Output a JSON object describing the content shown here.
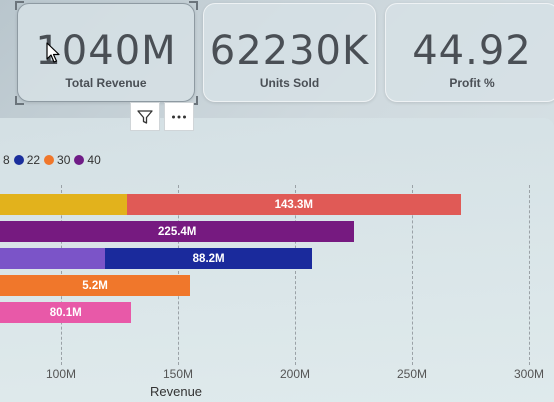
{
  "cards": [
    {
      "value": "1040M",
      "label": "Total Revenue"
    },
    {
      "value": "62230K",
      "label": "Units Sold"
    },
    {
      "value": "44.92",
      "label": "Profit %"
    }
  ],
  "toolbar": {
    "filter_icon": "filter-icon",
    "more_icon": "more-options-icon"
  },
  "legend": {
    "items": [
      {
        "label": "8",
        "color": "#000000"
      },
      {
        "label": "22",
        "color": "#1a2e9c"
      },
      {
        "label": "30",
        "color": "#f0772b"
      },
      {
        "label": "40",
        "color": "#6f1b86"
      }
    ]
  },
  "chart_data": {
    "type": "bar",
    "orientation": "horizontal",
    "stacked": true,
    "xlabel": "Revenue",
    "xticks": [
      "100M",
      "150M",
      "200M",
      "250M",
      "300M"
    ],
    "rows": [
      {
        "segments": [
          {
            "start": 40,
            "end": 128,
            "color": "#e2b21c",
            "label": ""
          },
          {
            "start": 128,
            "end": 271,
            "color": "#e05a56",
            "label": "143.3M"
          }
        ]
      },
      {
        "segments": [
          {
            "start": 40,
            "end": 225.4,
            "color": "#761a80",
            "label": "225.4M"
          }
        ]
      },
      {
        "segments": [
          {
            "start": 40,
            "end": 119,
            "color": "#7b54c8",
            "label": ""
          },
          {
            "start": 119,
            "end": 207.2,
            "color": "#1a2a9c",
            "label": "88.2M"
          }
        ]
      },
      {
        "segments": [
          {
            "start": 40,
            "end": 155.2,
            "color": "#f0772b",
            "label": "5.2M"
          }
        ]
      },
      {
        "segments": [
          {
            "start": 40,
            "end": 130.1,
            "color": "#e859a8",
            "label": "80.1M"
          }
        ]
      }
    ]
  }
}
